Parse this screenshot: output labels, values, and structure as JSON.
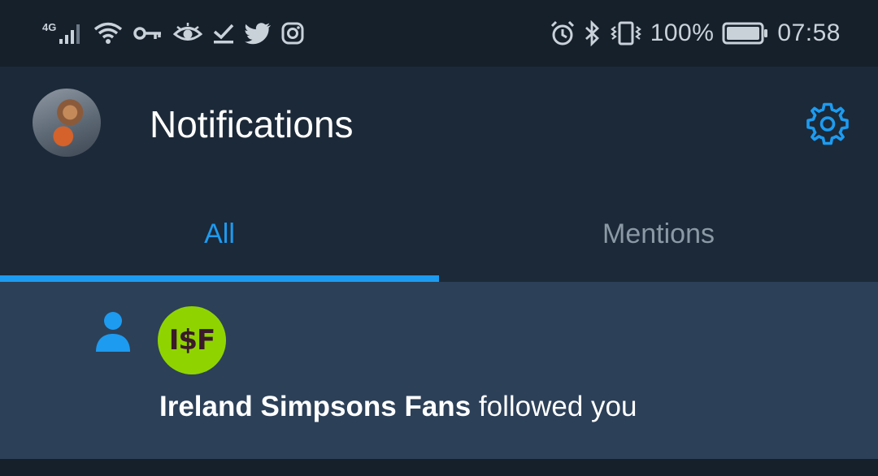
{
  "status_bar": {
    "network_type": "4G",
    "battery_percent": "100%",
    "time": "07:58",
    "left_icons": [
      "signal-icon",
      "wifi-icon",
      "vpn-key-icon",
      "eye-icon",
      "download-done-icon",
      "twitter-icon",
      "instagram-icon"
    ],
    "right_icons": [
      "alarm-icon",
      "bluetooth-icon",
      "vibrate-icon",
      "battery-icon"
    ]
  },
  "header": {
    "title": "Notifications",
    "settings_icon": "gear-icon"
  },
  "tabs": [
    {
      "label": "All",
      "active": true
    },
    {
      "label": "Mentions",
      "active": false
    }
  ],
  "notifications": [
    {
      "type_icon": "person-icon",
      "avatar_text": "I$F",
      "user_name": "Ireland Simpsons Fans",
      "action": " followed you"
    }
  ],
  "colors": {
    "accent": "#1d9bf0",
    "background": "#15202b",
    "header_bg": "#1c2938",
    "notification_bg": "#2c4058",
    "notif_avatar_bg": "#8fd400"
  }
}
